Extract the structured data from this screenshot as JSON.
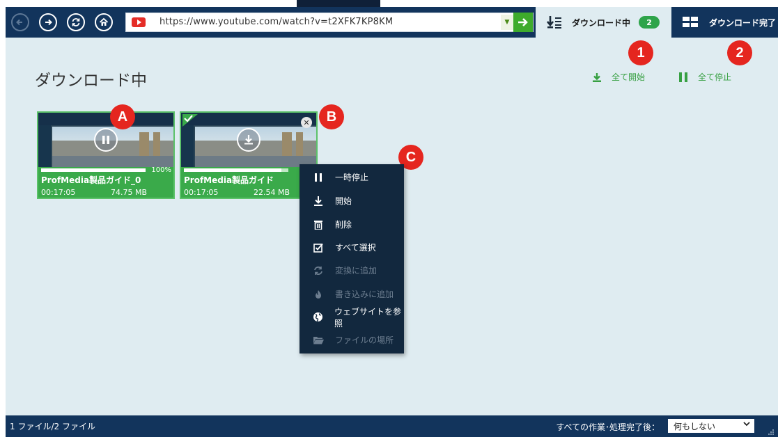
{
  "toolbar": {
    "url": "https://www.youtube.com/watch?v=t2XFK7KP8KM",
    "nav_icons": [
      "back-icon",
      "forward-icon",
      "refresh-icon",
      "home-icon"
    ]
  },
  "tabs": {
    "downloading": {
      "label": "ダウンロード中",
      "count": "2"
    },
    "completed": {
      "label": "ダウンロード完了"
    }
  },
  "main": {
    "title": "ダウンロード中",
    "start_all": "全て開始",
    "stop_all": "全て停止"
  },
  "markers": {
    "one": "1",
    "two": "2",
    "a": "A",
    "b": "B",
    "c": "C"
  },
  "cards": [
    {
      "name": "ProfMedia製品ガイド_0",
      "duration": "00:17:05",
      "size": "74.75 MB",
      "percent": "100%",
      "progress": 1.0,
      "state": "pause-icon"
    },
    {
      "name": "ProfMedia製品ガイド",
      "duration": "00:17:05",
      "size": "22.54 MB",
      "progress": 0.93,
      "state": "download-icon"
    }
  ],
  "context_menu": {
    "items": [
      {
        "label": "一時停止",
        "icon": "pause-icon",
        "enabled": true
      },
      {
        "label": "開始",
        "icon": "download-icon",
        "enabled": true
      },
      {
        "label": "削除",
        "icon": "trash-icon",
        "enabled": true
      },
      {
        "label": "すべて選択",
        "icon": "checkbox-icon",
        "enabled": true
      },
      {
        "label": "変換に追加",
        "icon": "convert-icon",
        "enabled": false
      },
      {
        "label": "書き込みに追加",
        "icon": "burn-icon",
        "enabled": false
      },
      {
        "label": "ウェブサイトを参照",
        "icon": "globe-icon",
        "enabled": true
      },
      {
        "label": "ファイルの場所",
        "icon": "folder-icon",
        "enabled": false
      }
    ]
  },
  "status": {
    "file_count": "1 ファイル/2 ファイル",
    "after_label": "すべての作業･処理完了後：",
    "after_value": "何もしない"
  },
  "colors": {
    "toolbar": "#12345c",
    "main_bg": "#dfecf1",
    "accent_green": "#37a042",
    "marker_red": "#e5261f",
    "menu_bg": "#12283e"
  }
}
